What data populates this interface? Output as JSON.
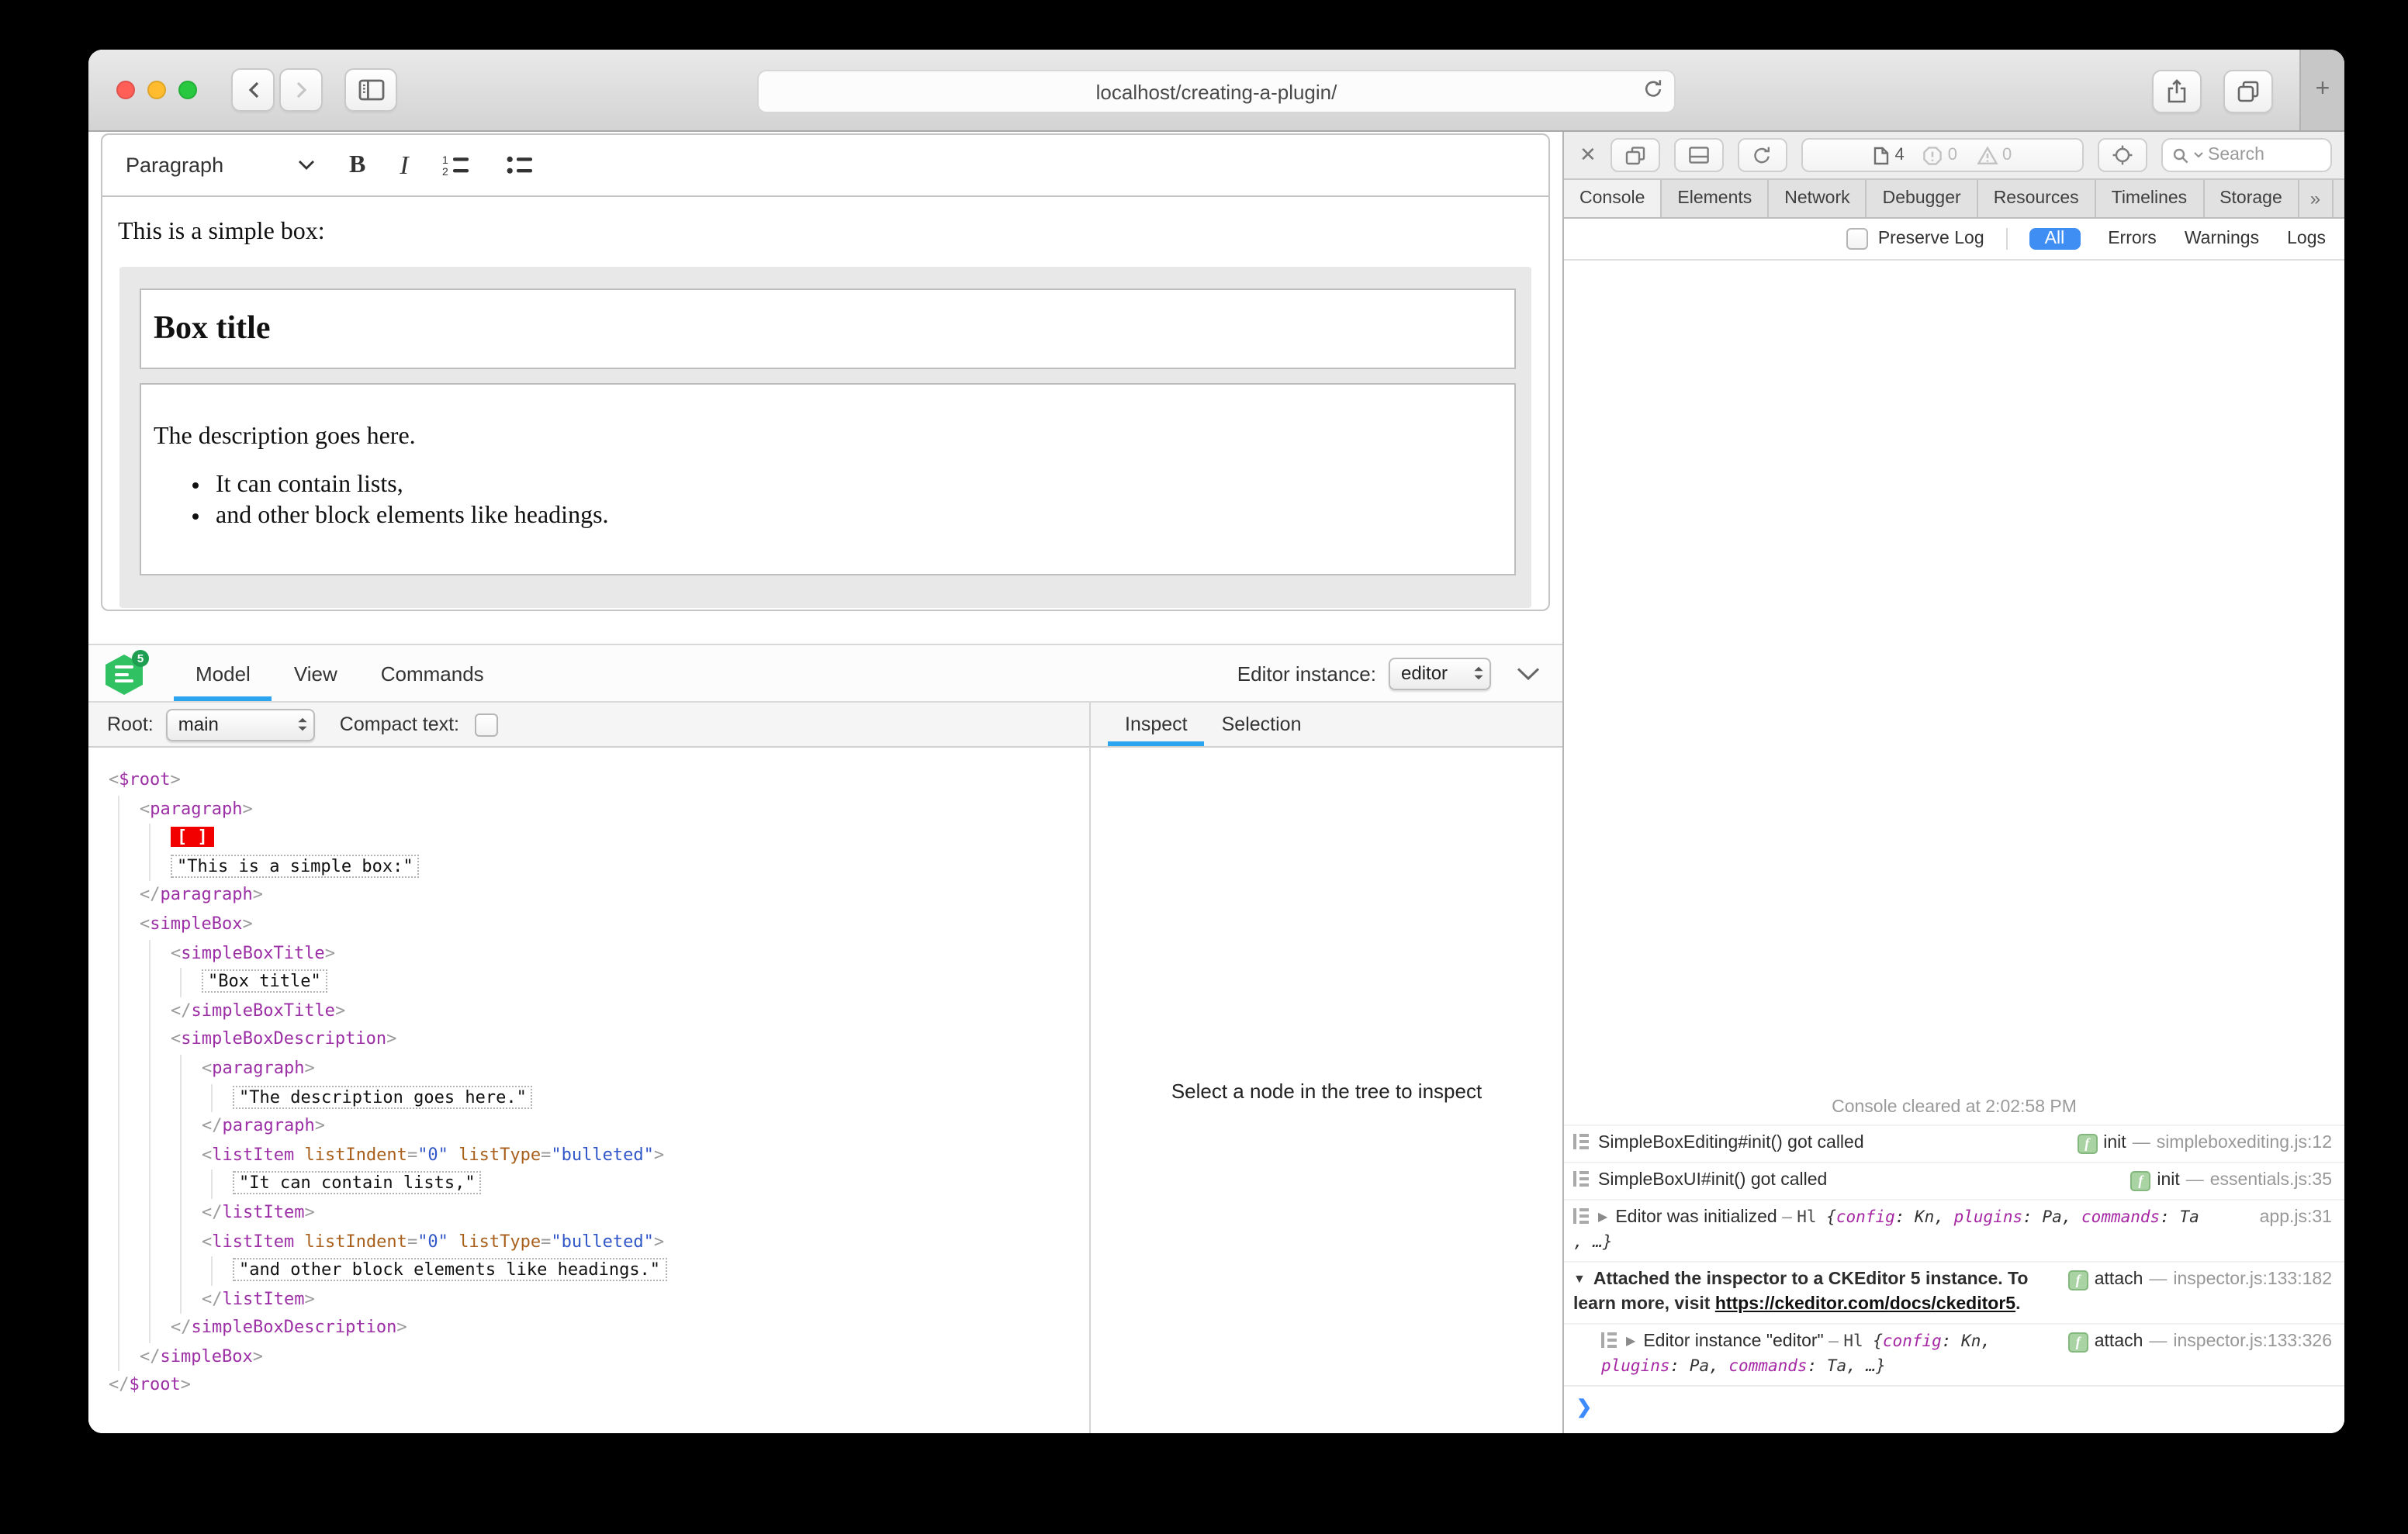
{
  "browser": {
    "url": "localhost/creating-a-plugin/",
    "new_tab_glyph": "+"
  },
  "editor": {
    "toolbar": {
      "heading_label": "Paragraph",
      "bold_label": "B",
      "italic_label": "I"
    },
    "content": {
      "intro": "This is a simple box:",
      "box_title": "Box title",
      "box_description": "The description goes here.",
      "box_list": [
        "It can contain lists,",
        "and other block elements like headings."
      ]
    }
  },
  "inspector_panel": {
    "logo_badge": "5",
    "tabs": [
      "Model",
      "View",
      "Commands"
    ],
    "active_tab": "Model",
    "editor_instance_label": "Editor instance:",
    "editor_instance_value": "editor",
    "root_label": "Root:",
    "root_value": "main",
    "compact_text_label": "Compact text:",
    "side_tabs": [
      "Inspect",
      "Selection"
    ],
    "side_active_tab": "Inspect",
    "placeholder": "Select a node in the tree to inspect",
    "tree": [
      {
        "i": 0,
        "s": [
          [
            "p",
            "<"
          ],
          [
            "t",
            "$root"
          ],
          [
            "p",
            ">"
          ]
        ]
      },
      {
        "i": 1,
        "s": [
          [
            "p",
            "<"
          ],
          [
            "t",
            "paragraph"
          ],
          [
            "p",
            ">"
          ]
        ]
      },
      {
        "i": 2,
        "s": [
          [
            "m",
            "[ ]"
          ]
        ]
      },
      {
        "i": 2,
        "s": [
          [
            "s",
            "\"This is a simple box:\""
          ]
        ]
      },
      {
        "i": 1,
        "s": [
          [
            "p",
            "</"
          ],
          [
            "t",
            "paragraph"
          ],
          [
            "p",
            ">"
          ]
        ]
      },
      {
        "i": 1,
        "s": [
          [
            "p",
            "<"
          ],
          [
            "t",
            "simpleBox"
          ],
          [
            "p",
            ">"
          ]
        ]
      },
      {
        "i": 2,
        "s": [
          [
            "p",
            "<"
          ],
          [
            "t",
            "simpleBoxTitle"
          ],
          [
            "p",
            ">"
          ]
        ]
      },
      {
        "i": 3,
        "s": [
          [
            "s",
            "\"Box title\""
          ]
        ]
      },
      {
        "i": 2,
        "s": [
          [
            "p",
            "</"
          ],
          [
            "t",
            "simpleBoxTitle"
          ],
          [
            "p",
            ">"
          ]
        ]
      },
      {
        "i": 2,
        "s": [
          [
            "p",
            "<"
          ],
          [
            "t",
            "simpleBoxDescription"
          ],
          [
            "p",
            ">"
          ]
        ]
      },
      {
        "i": 3,
        "s": [
          [
            "p",
            "<"
          ],
          [
            "t",
            "paragraph"
          ],
          [
            "p",
            ">"
          ]
        ]
      },
      {
        "i": 4,
        "s": [
          [
            "s",
            "\"The description goes here.\""
          ]
        ]
      },
      {
        "i": 3,
        "s": [
          [
            "p",
            "</"
          ],
          [
            "t",
            "paragraph"
          ],
          [
            "p",
            ">"
          ]
        ]
      },
      {
        "i": 3,
        "s": [
          [
            "p",
            "<"
          ],
          [
            "t",
            "listItem"
          ],
          [
            "w",
            " "
          ],
          [
            "a",
            "listIndent"
          ],
          [
            "p",
            "="
          ],
          [
            "v",
            "\"0\""
          ],
          [
            "w",
            " "
          ],
          [
            "a",
            "listType"
          ],
          [
            "p",
            "="
          ],
          [
            "v",
            "\"bulleted\""
          ],
          [
            "p",
            ">"
          ]
        ]
      },
      {
        "i": 4,
        "s": [
          [
            "s",
            "\"It can contain lists,\""
          ]
        ]
      },
      {
        "i": 3,
        "s": [
          [
            "p",
            "</"
          ],
          [
            "t",
            "listItem"
          ],
          [
            "p",
            ">"
          ]
        ]
      },
      {
        "i": 3,
        "s": [
          [
            "p",
            "<"
          ],
          [
            "t",
            "listItem"
          ],
          [
            "w",
            " "
          ],
          [
            "a",
            "listIndent"
          ],
          [
            "p",
            "="
          ],
          [
            "v",
            "\"0\""
          ],
          [
            "w",
            " "
          ],
          [
            "a",
            "listType"
          ],
          [
            "p",
            "="
          ],
          [
            "v",
            "\"bulleted\""
          ],
          [
            "p",
            ">"
          ]
        ]
      },
      {
        "i": 4,
        "s": [
          [
            "s",
            "\"and other block elements like headings.\""
          ]
        ]
      },
      {
        "i": 3,
        "s": [
          [
            "p",
            "</"
          ],
          [
            "t",
            "listItem"
          ],
          [
            "p",
            ">"
          ]
        ]
      },
      {
        "i": 2,
        "s": [
          [
            "p",
            "</"
          ],
          [
            "t",
            "simpleBoxDescription"
          ],
          [
            "p",
            ">"
          ]
        ]
      },
      {
        "i": 1,
        "s": [
          [
            "p",
            "</"
          ],
          [
            "t",
            "simpleBox"
          ],
          [
            "p",
            ">"
          ]
        ]
      },
      {
        "i": 0,
        "s": [
          [
            "p",
            "</"
          ],
          [
            "t",
            "$root"
          ],
          [
            "p",
            ">"
          ]
        ]
      }
    ]
  },
  "devtools": {
    "toolbar": {
      "close_glyph": "✕",
      "page_count": "4",
      "error_count": "0",
      "warning_count": "0",
      "search_placeholder": "Search"
    },
    "tabs": [
      "Console",
      "Elements",
      "Network",
      "Debugger",
      "Resources",
      "Timelines",
      "Storage"
    ],
    "active_tab": "Console",
    "tabs_extra": {
      "more": "»",
      "add": "+",
      "settings": "⚙"
    },
    "filter": {
      "preserve_label": "Preserve Log",
      "scopes": [
        "All",
        "Errors",
        "Warnings",
        "Logs"
      ],
      "active_scope": "All"
    },
    "cleared_message": "Console cleared at 2:02:58 PM",
    "function_badge_glyph": "f",
    "messages": [
      {
        "icon": "log",
        "parts": [
          [
            "pl",
            "SimpleBoxEditing#init() got called"
          ]
        ],
        "fn": "init",
        "loc": "simpleboxediting.js:12"
      },
      {
        "icon": "log",
        "parts": [
          [
            "pl",
            "SimpleBoxUI#init() got called"
          ]
        ],
        "fn": "init",
        "loc": "essentials.js:35"
      },
      {
        "icon": "log",
        "disclosure": "closed",
        "parts": [
          [
            "pl",
            "Editor was initialized"
          ],
          [
            "dash",
            " – "
          ],
          [
            "cls",
            "Hl "
          ],
          [
            "ob",
            "{"
          ],
          [
            "key",
            "config"
          ],
          [
            "ob",
            ": Kn, "
          ],
          [
            "key",
            "plugins"
          ],
          [
            "ob",
            ": Pa, "
          ],
          [
            "key",
            "commands"
          ],
          [
            "ob",
            ": Ta"
          ],
          [
            "br",
            ""
          ],
          [
            "ob",
            ", …}"
          ]
        ],
        "loc": "app.js:31"
      },
      {
        "disclosure": "open",
        "bold": true,
        "parts": [
          [
            "pl",
            "Attached the inspector to a CKEditor 5 instance. To learn more, visit "
          ],
          [
            "lk",
            "https://ckeditor.com/docs/ckeditor5"
          ],
          [
            "pl",
            "."
          ]
        ],
        "fn": "attach",
        "loc": "inspector.js:133:182"
      },
      {
        "icon": "log",
        "nested": true,
        "disclosure": "closed",
        "parts": [
          [
            "pl",
            "Editor instance \"editor\""
          ],
          [
            "dash",
            " – "
          ],
          [
            "cls",
            "Hl "
          ],
          [
            "ob",
            "{"
          ],
          [
            "key",
            "config"
          ],
          [
            "ob",
            ": Kn,"
          ],
          [
            "br",
            ""
          ],
          [
            "key",
            "plugins"
          ],
          [
            "ob",
            ": Pa, "
          ],
          [
            "key",
            "commands"
          ],
          [
            "ob",
            ": Ta, …}"
          ]
        ],
        "fn": "attach",
        "loc": "inspector.js:133:326"
      }
    ],
    "prompt_glyph": "❯"
  }
}
